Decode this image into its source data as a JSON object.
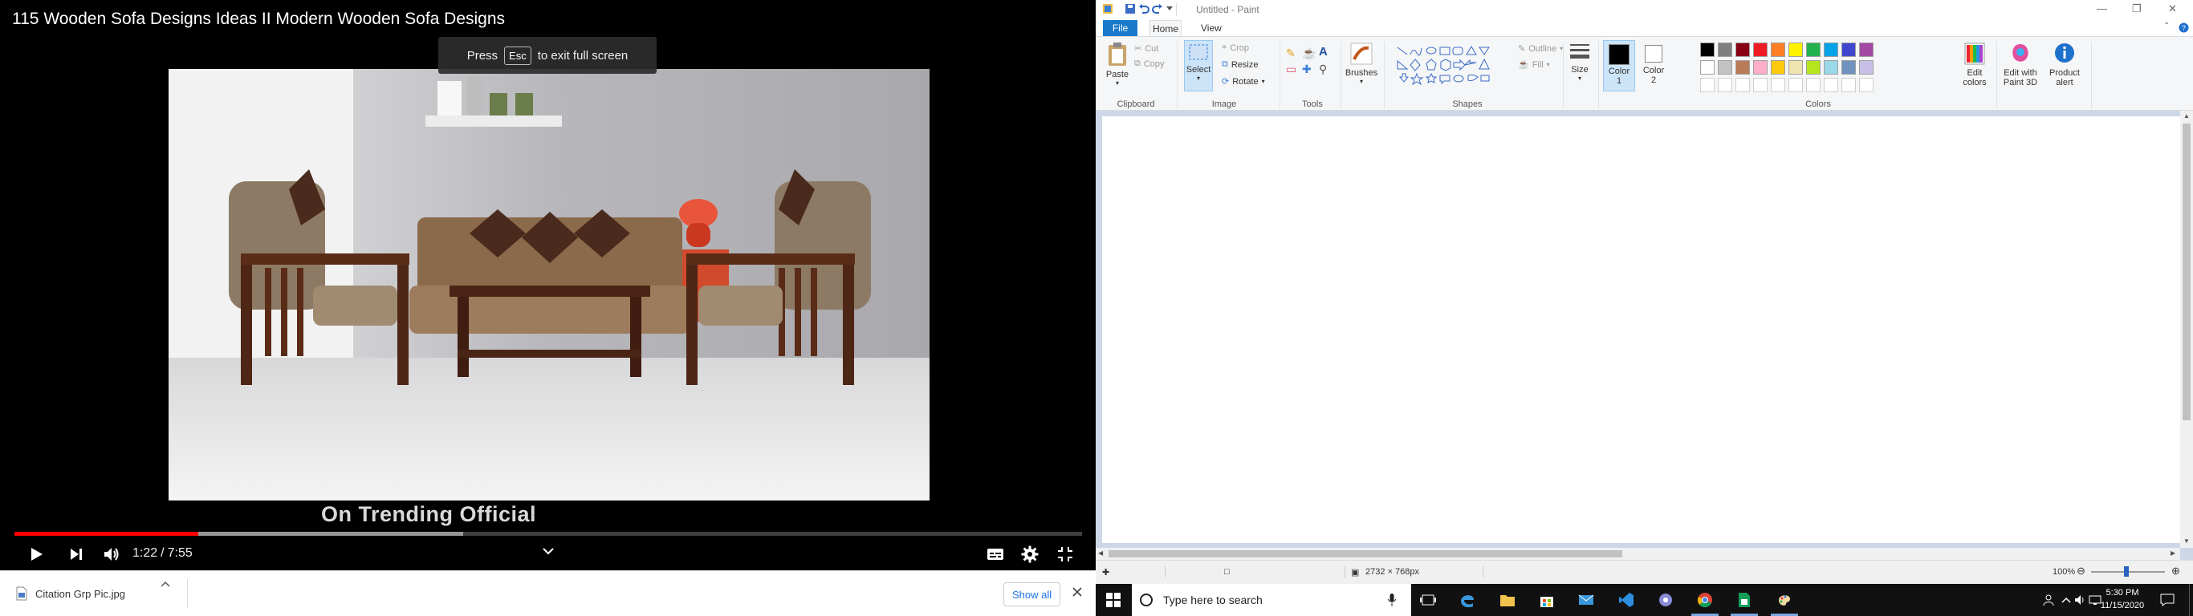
{
  "youtube": {
    "video_title": "115 Wooden Sofa Designs Ideas II Modern Wooden Sofa Designs",
    "fullscreen_toast": {
      "press": "Press",
      "key": "Esc",
      "rest": "to exit full screen"
    },
    "watermark": "On Trending Official",
    "current_time": "1:22",
    "time_separator": "/",
    "duration": "7:55",
    "played_fraction": 0.172,
    "buffered_fraction": 0.42,
    "icons": [
      "play-icon",
      "next-icon",
      "volume-icon",
      "chevron-down-icon",
      "subtitles-icon",
      "settings-icon",
      "exit-fullscreen-icon"
    ]
  },
  "downloads": {
    "file_name": "Citation Grp Pic.jpg",
    "show_all": "Show all"
  },
  "paint": {
    "window_title": "Untitled - Paint",
    "tabs": {
      "file": "File",
      "home": "Home",
      "view": "View"
    },
    "clipboard": {
      "paste": "Paste",
      "cut": "Cut",
      "copy": "Copy",
      "group": "Clipboard"
    },
    "image": {
      "select": "Select",
      "crop": "Crop",
      "resize": "Resize",
      "rotate": "Rotate",
      "group": "Image"
    },
    "tools": {
      "group": "Tools"
    },
    "brushes": "Brushes",
    "shapes": {
      "outline": "Outline",
      "fill": "Fill",
      "group": "Shapes"
    },
    "size": "Size",
    "color1": {
      "line1": "Color",
      "line2": "1"
    },
    "color2": {
      "line1": "Color",
      "line2": "2"
    },
    "edit_colors": {
      "line1": "Edit",
      "line2": "colors"
    },
    "edit_3d": {
      "line1": "Edit with",
      "line2": "Paint 3D"
    },
    "product_alert": {
      "line1": "Product",
      "line2": "alert"
    },
    "colors_group": "Colors",
    "palette_row1": [
      "#000000",
      "#7f7f7f",
      "#880015",
      "#ed1c24",
      "#ff7f27",
      "#fff200",
      "#22b14c",
      "#00a2e8",
      "#3f48cc",
      "#a349a4"
    ],
    "palette_row2": [
      "#ffffff",
      "#c3c3c3",
      "#b97a57",
      "#ffaec9",
      "#ffc90e",
      "#efe4b0",
      "#b5e61d",
      "#99d9ea",
      "#7092be",
      "#c8bfe7"
    ],
    "status_dimensions": "2732 × 768px",
    "zoom": "100%"
  },
  "taskbar": {
    "search_placeholder": "Type here to search",
    "time": "5:30 PM",
    "date": "11/15/2020"
  }
}
